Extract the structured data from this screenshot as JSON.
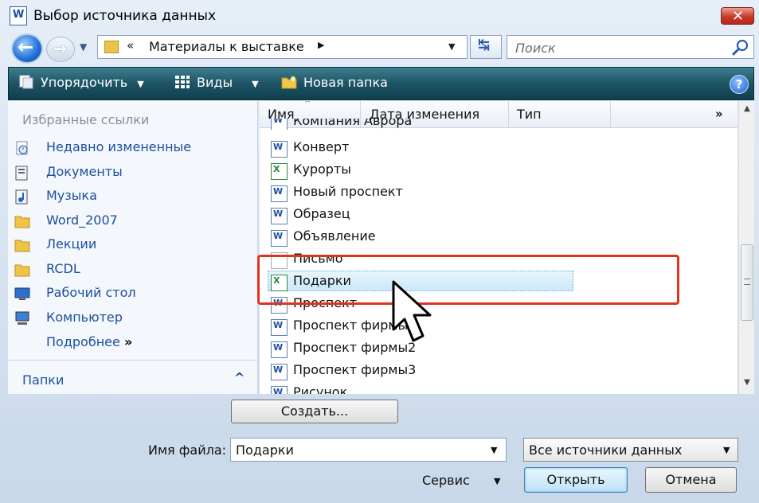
{
  "window": {
    "title": "Выбор источника данных",
    "title_icon": "W",
    "close_glyph": "✕"
  },
  "nav": {
    "back_glyph": "←",
    "forward_glyph": "→",
    "address_chevron": "«",
    "address_text": "Материалы к выставке",
    "address_arrow": "▶",
    "refresh_glyph": "↹",
    "search_placeholder": "Поиск"
  },
  "toolbar": {
    "organize_label": "Упорядочить",
    "views_label": "Виды",
    "new_folder_label": "Новая папка",
    "help_glyph": "?"
  },
  "sidebar": {
    "header": "Избранные ссылки",
    "items": [
      {
        "label": "Недавно измененные",
        "icon": "recent-places-icon"
      },
      {
        "label": "Документы",
        "icon": "documents-icon"
      },
      {
        "label": "Музыка",
        "icon": "music-icon"
      },
      {
        "label": "Word_2007",
        "icon": "folder-icon"
      },
      {
        "label": "Лекции",
        "icon": "folder-icon"
      },
      {
        "label": "RCDL",
        "icon": "folder-icon"
      },
      {
        "label": "Рабочий стол",
        "icon": "desktop-icon"
      },
      {
        "label": "Компьютер",
        "icon": "computer-icon"
      }
    ],
    "more_label": "Подробнее",
    "more_glyph": "»",
    "folders_label": "Папки",
    "folders_glyph": "^"
  },
  "file_list": {
    "columns": [
      "Имя",
      "Дата изменения",
      "Тип"
    ],
    "more_columns_glyph": "»",
    "sort_glyph": "^",
    "files": [
      {
        "name": "Компания Аврора",
        "icon": "word-doc-icon"
      },
      {
        "name": "Конверт",
        "icon": "word-doc-icon"
      },
      {
        "name": "Курорты",
        "icon": "excel-doc-icon"
      },
      {
        "name": "Новый проспект",
        "icon": "word-doc-icon"
      },
      {
        "name": "Образец",
        "icon": "word-doc-icon"
      },
      {
        "name": "Объявление",
        "icon": "word-doc-icon"
      },
      {
        "name": "Письмо",
        "icon": "text-doc-icon"
      },
      {
        "name": "Подарки",
        "icon": "excel-doc-icon",
        "selected": true
      },
      {
        "name": "Проспект",
        "icon": "word-doc-icon"
      },
      {
        "name": "Проспект фирмы",
        "icon": "word-doc-icon"
      },
      {
        "name": "Проспект фирмы2",
        "icon": "word-doc-icon"
      },
      {
        "name": "Проспект фирмы3",
        "icon": "word-doc-icon"
      },
      {
        "name": "Рисунок",
        "icon": "word-doc-icon"
      }
    ]
  },
  "footer": {
    "create_label": "Создать...",
    "filename_label": "Имя файла:",
    "filename_value": "Подарки",
    "filter_value": "Все источники данных",
    "tools_label": "Сервис",
    "open_label": "Открыть",
    "cancel_label": "Отмена",
    "dropdown_glyph": "▼"
  },
  "colors": {
    "link": "#1c4fa0",
    "toolbar": "#1d5465",
    "annotation": "#e0331f",
    "selection": "#c9e8fa"
  }
}
